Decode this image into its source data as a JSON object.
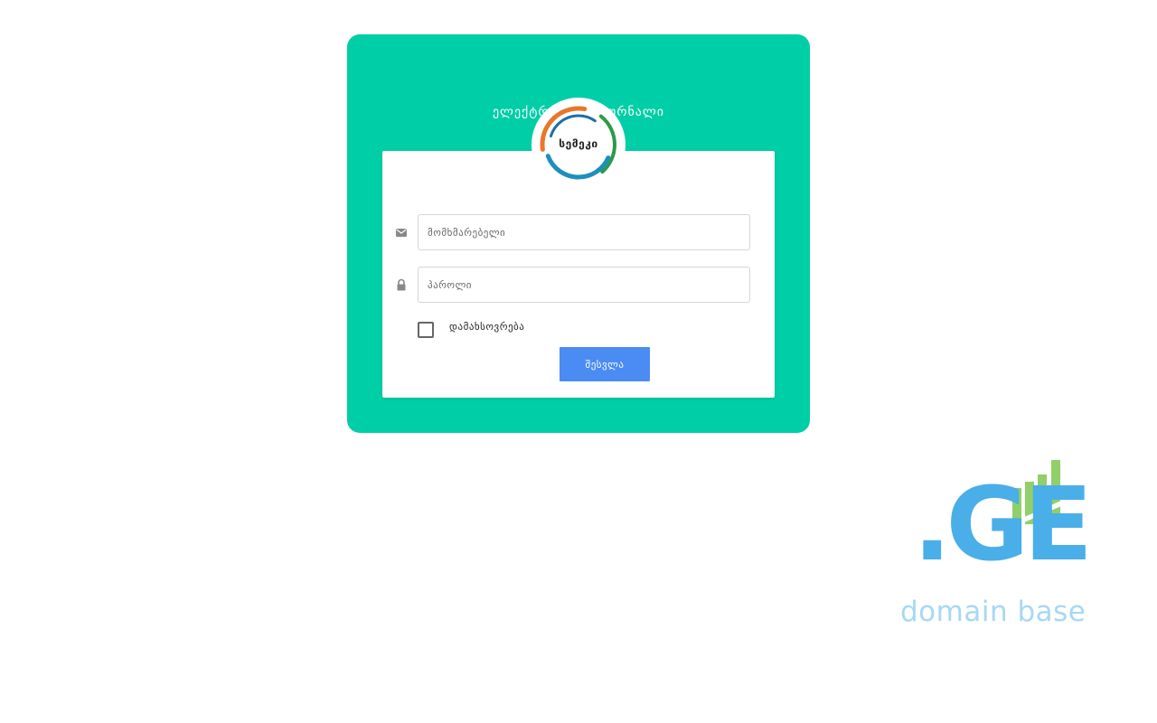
{
  "header": {
    "title": "ელექტრონული ჟურნალი",
    "logo_text": "სემეკი"
  },
  "form": {
    "username": {
      "value": "",
      "placeholder": "მომხმარებელი",
      "icon": "envelope-icon"
    },
    "password": {
      "value": "",
      "placeholder": "პაროლი",
      "icon": "lock-icon"
    },
    "remember": {
      "label": "დამახსოვრება",
      "checked": false
    },
    "submit_label": "შესვლა"
  },
  "badge": {
    "domain": ".GE",
    "subtitle": "domain base"
  },
  "colors": {
    "panel": "#00cea6",
    "button": "#4b8bf4",
    "badge_blue": "#4aaee8",
    "badge_light_blue": "#a7d8f3",
    "badge_green": "#8fd068"
  }
}
